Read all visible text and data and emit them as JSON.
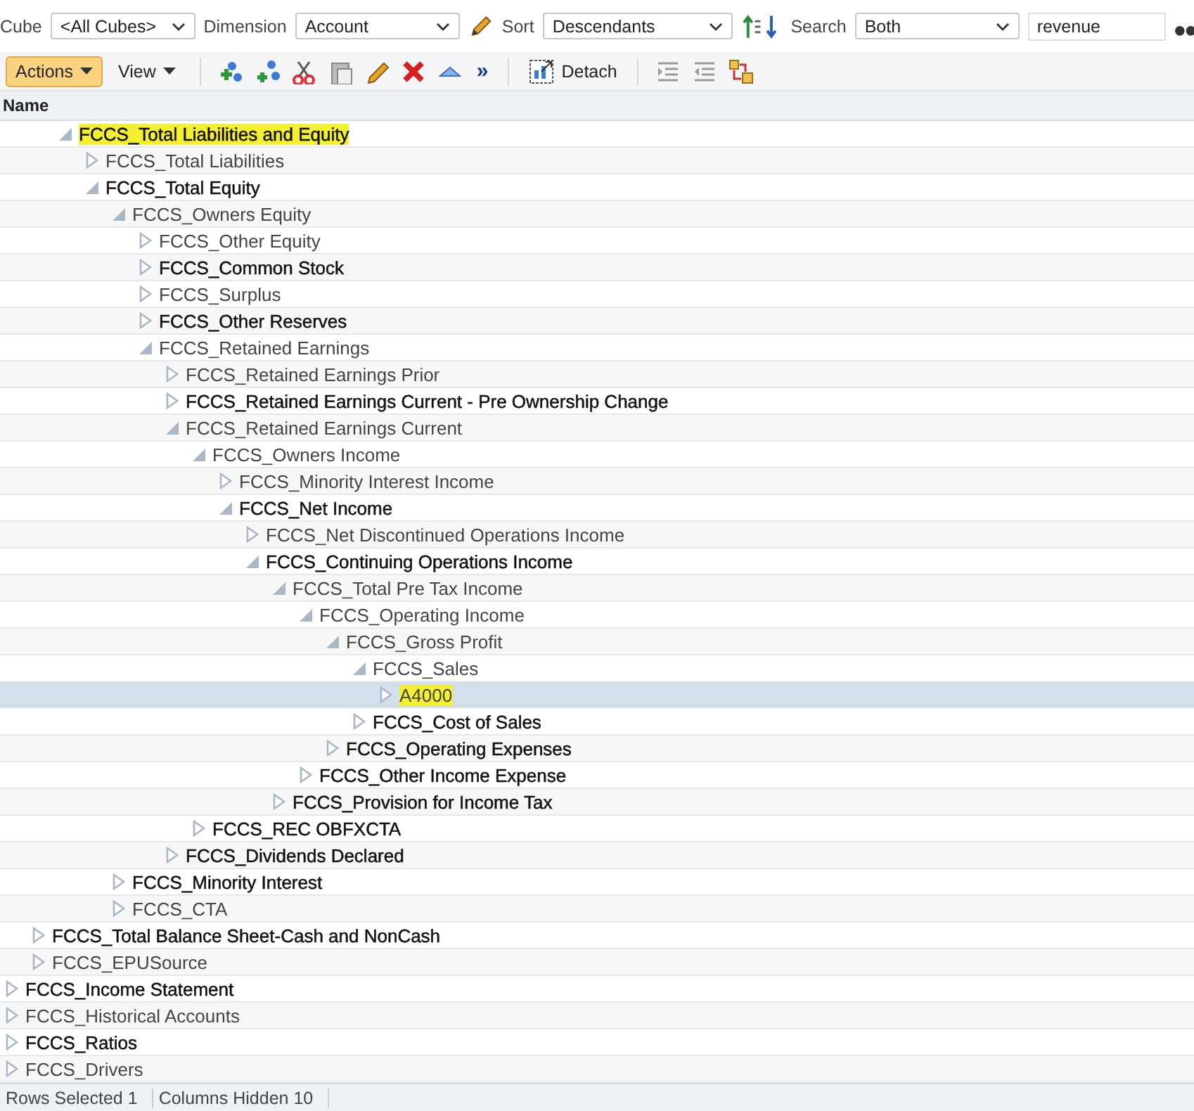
{
  "filter_bar": {
    "fields": [
      {
        "label": "Cube",
        "value": "<All Cubes>",
        "kind": "dropdown"
      },
      {
        "label": "Dimension",
        "value": "Account",
        "kind": "dropdown",
        "edit": true
      },
      {
        "label": "Sort",
        "value": "Descendants",
        "kind": "dropdown",
        "sort": true
      },
      {
        "label": "Search",
        "value": "Both",
        "kind": "dropdown"
      },
      {
        "value": "revenue",
        "kind": "text"
      }
    ]
  },
  "toolbar": {
    "menus": [
      {
        "label": "Actions",
        "selected": true
      },
      {
        "label": "View",
        "selected": false
      }
    ],
    "overflow": "»",
    "detach": "Detach"
  },
  "header": "Name",
  "tree": [
    {
      "children": [
        {
          "children": [
            {
              "label": "FCCS_Total Liabilities and Equity",
              "expanded": true,
              "strong": true,
              "highlighted": true,
              "selected": false,
              "children": [
                {
                  "label": "FCCS_Total Liabilities",
                  "expanded": false,
                  "strong": false,
                  "highlighted": false,
                  "selected": false
                },
                {
                  "label": "FCCS_Total Equity",
                  "expanded": true,
                  "strong": true,
                  "highlighted": false,
                  "selected": false,
                  "children": [
                    {
                      "label": "FCCS_Owners Equity",
                      "expanded": true,
                      "strong": false,
                      "highlighted": false,
                      "selected": false,
                      "children": [
                        {
                          "label": "FCCS_Other Equity",
                          "expanded": false,
                          "strong": false,
                          "highlighted": false,
                          "selected": false
                        },
                        {
                          "label": "FCCS_Common Stock",
                          "expanded": false,
                          "strong": true,
                          "highlighted": false,
                          "selected": false
                        },
                        {
                          "label": "FCCS_Surplus",
                          "expanded": false,
                          "strong": false,
                          "highlighted": false,
                          "selected": false
                        },
                        {
                          "label": "FCCS_Other Reserves",
                          "expanded": false,
                          "strong": true,
                          "highlighted": false,
                          "selected": false
                        },
                        {
                          "label": "FCCS_Retained Earnings",
                          "expanded": true,
                          "strong": false,
                          "highlighted": false,
                          "selected": false,
                          "children": [
                            {
                              "label": "FCCS_Retained Earnings Prior",
                              "expanded": false,
                              "strong": false,
                              "highlighted": false,
                              "selected": false
                            },
                            {
                              "label": "FCCS_Retained Earnings Current - Pre Ownership Change",
                              "expanded": false,
                              "strong": true,
                              "highlighted": false,
                              "selected": false
                            },
                            {
                              "label": "FCCS_Retained Earnings Current",
                              "expanded": true,
                              "strong": false,
                              "highlighted": false,
                              "selected": false,
                              "children": [
                                {
                                  "label": "FCCS_Owners Income",
                                  "expanded": true,
                                  "strong": false,
                                  "highlighted": false,
                                  "selected": false,
                                  "children": [
                                    {
                                      "label": "FCCS_Minority Interest Income",
                                      "expanded": false,
                                      "strong": false,
                                      "highlighted": false,
                                      "selected": false
                                    },
                                    {
                                      "label": "FCCS_Net Income",
                                      "expanded": true,
                                      "strong": true,
                                      "highlighted": false,
                                      "selected": false,
                                      "children": [
                                        {
                                          "label": "FCCS_Net Discontinued Operations Income",
                                          "expanded": false,
                                          "strong": false,
                                          "highlighted": false,
                                          "selected": false
                                        },
                                        {
                                          "label": "FCCS_Continuing Operations Income",
                                          "expanded": true,
                                          "strong": true,
                                          "highlighted": false,
                                          "selected": false,
                                          "children": [
                                            {
                                              "label": "FCCS_Total Pre Tax Income",
                                              "expanded": true,
                                              "strong": false,
                                              "highlighted": false,
                                              "selected": false,
                                              "children": [
                                                {
                                                  "label": "FCCS_Operating Income",
                                                  "expanded": true,
                                                  "strong": false,
                                                  "highlighted": false,
                                                  "selected": false,
                                                  "children": [
                                                    {
                                                      "label": "FCCS_Gross Profit",
                                                      "expanded": true,
                                                      "strong": false,
                                                      "highlighted": false,
                                                      "selected": false,
                                                      "children": [
                                                        {
                                                          "label": "FCCS_Sales",
                                                          "expanded": true,
                                                          "strong": false,
                                                          "highlighted": false,
                                                          "selected": false,
                                                          "children": [
                                                            {
                                                              "label": "A4000",
                                                              "expanded": false,
                                                              "strong": false,
                                                              "highlighted": true,
                                                              "selected": true
                                                            }
                                                          ]
                                                        },
                                                        {
                                                          "label": "FCCS_Cost of Sales",
                                                          "expanded": false,
                                                          "strong": true,
                                                          "highlighted": false,
                                                          "selected": false
                                                        }
                                                      ]
                                                    },
                                                    {
                                                      "label": "FCCS_Operating Expenses",
                                                      "expanded": false,
                                                      "strong": true,
                                                      "highlighted": false,
                                                      "selected": false
                                                    }
                                                  ]
                                                },
                                                {
                                                  "label": "FCCS_Other Income Expense",
                                                  "expanded": false,
                                                  "strong": true,
                                                  "highlighted": false,
                                                  "selected": false
                                                }
                                              ]
                                            },
                                            {
                                              "label": "FCCS_Provision for Income Tax",
                                              "expanded": false,
                                              "strong": true,
                                              "highlighted": false,
                                              "selected": false
                                            }
                                          ]
                                        }
                                      ]
                                    }
                                  ]
                                },
                                {
                                  "label": "FCCS_REC OBFXCTA",
                                  "expanded": false,
                                  "strong": true,
                                  "highlighted": false,
                                  "selected": false
                                }
                              ]
                            },
                            {
                              "label": "FCCS_Dividends Declared",
                              "expanded": false,
                              "strong": true,
                              "highlighted": false,
                              "selected": false
                            }
                          ]
                        }
                      ]
                    },
                    {
                      "label": "FCCS_Minority Interest",
                      "expanded": false,
                      "strong": true,
                      "highlighted": false,
                      "selected": false
                    },
                    {
                      "label": "FCCS_CTA",
                      "expanded": false,
                      "strong": false,
                      "highlighted": false,
                      "selected": false
                    }
                  ]
                }
              ]
            }
          ]
        },
        {
          "label": "FCCS_Total Balance Sheet-Cash and NonCash",
          "expanded": false,
          "strong": true,
          "highlighted": false,
          "selected": false
        },
        {
          "label": "FCCS_EPUSource",
          "expanded": false,
          "strong": false,
          "highlighted": false,
          "selected": false
        }
      ]
    },
    {
      "label": "FCCS_Income Statement",
      "expanded": false,
      "strong": true,
      "highlighted": false,
      "selected": false
    },
    {
      "label": "FCCS_Historical Accounts",
      "expanded": false,
      "strong": false,
      "highlighted": false,
      "selected": false
    },
    {
      "label": "FCCS_Ratios",
      "expanded": false,
      "strong": true,
      "highlighted": false,
      "selected": false
    },
    {
      "label": "FCCS_Drivers",
      "expanded": false,
      "strong": false,
      "highlighted": false,
      "selected": false
    }
  ],
  "status_bar": [
    {
      "label": "Rows Selected",
      "value": "1"
    },
    {
      "label": "Columns Hidden",
      "value": "10"
    }
  ]
}
